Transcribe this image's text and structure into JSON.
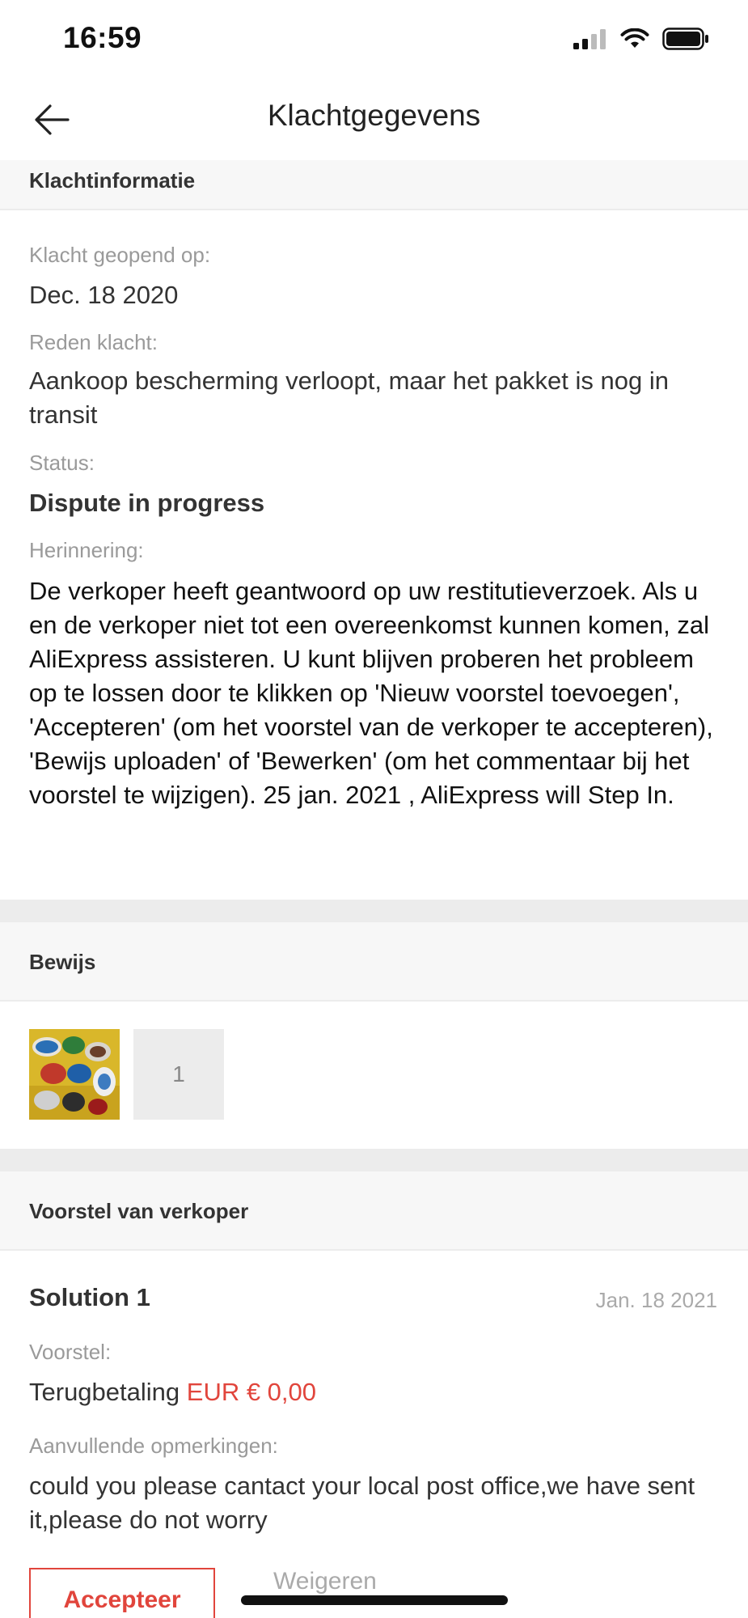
{
  "status_bar": {
    "time": "16:59"
  },
  "nav": {
    "title": "Klachtgegevens"
  },
  "complaint_info": {
    "header": "Klachtinformatie",
    "opened_label": "Klacht geopend op:",
    "opened_value": "Dec. 18 2020",
    "reason_label": "Reden klacht:",
    "reason_value": "Aankoop bescherming verloopt, maar het pakket is nog in transit",
    "status_label": "Status:",
    "status_value": "Dispute in progress",
    "reminder_label": "Herinnering:",
    "reminder_value": "De verkoper heeft geantwoord op uw restitutieverzoek. Als u en de verkoper niet tot een overeenkomst kunnen komen, zal AliExpress assisteren. U kunt blijven proberen het probleem op te lossen door te klikken op 'Nieuw voorstel toevoegen', 'Accepteren' (om het voorstel van de verkoper te accepteren), 'Bewijs uploaden' of 'Bewerken' (om het commentaar bij het voorstel te wijzigen). 25 jan. 2021 , AliExpress will Step In."
  },
  "evidence": {
    "header": "Bewijs",
    "more_count": "1"
  },
  "seller_proposal": {
    "header": "Voorstel van verkoper",
    "solution_title": "Solution 1",
    "solution_date": "Jan. 18 2021",
    "proposal_label": "Voorstel:",
    "proposal_type": "Terugbetaling",
    "proposal_amount": "EUR € 0,00",
    "remarks_label": "Aanvullende opmerkingen:",
    "remarks_value": "could you please cantact your local post office,we have sent it,please do not worry",
    "accept_label": "Accepteer",
    "reject_label": "Weigeren"
  },
  "colors": {
    "accent": "#e1453c",
    "muted_text": "#9a9a9a",
    "section_bg": "#f7f7f7",
    "band_bg": "#ececec"
  }
}
